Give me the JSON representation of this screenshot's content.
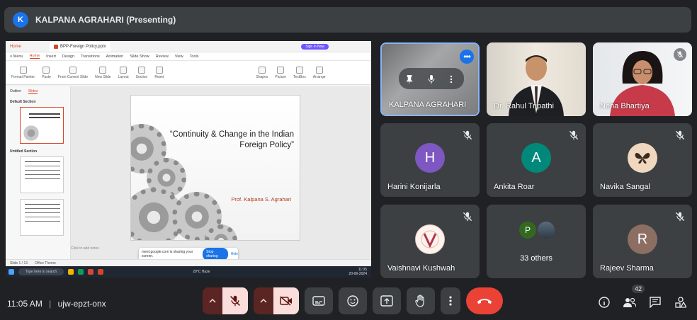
{
  "topbar": {
    "avatar_letter": "K",
    "title": "KALPANA AGRAHARI (Presenting)"
  },
  "presentation": {
    "app_tab": "BPP-Foreign Policy.pptx",
    "home": "Home",
    "signin": "Sign in Now",
    "menu": [
      "≡ Menu",
      "Home",
      "Insert",
      "Design",
      "Transitions",
      "Animation",
      "Slide Show",
      "Review",
      "View",
      "Tools"
    ],
    "ribbon": [
      "Format Painter",
      "Paste",
      "From Current Slide",
      "New Slide",
      "Layout",
      "Section",
      "Reset",
      "Shapes",
      "Picture",
      "TextBox",
      "Arrange"
    ],
    "sidebar": {
      "outline_tab": "Outline",
      "slides_tab": "Slides",
      "section1": "Default Section",
      "section2": "Untitled Section"
    },
    "slide": {
      "title_line1": "“Continuity & Change in the Indian",
      "title_line2": "Foreign Policy”",
      "author": "Prof. Kalpana S. Agrahari"
    },
    "notes": "Click to add notes",
    "share_banner": {
      "text": "meet.google.com is sharing your screen.",
      "stop": "Stop sharing",
      "hide": "Hide"
    },
    "status": {
      "slide_count": "Slide 1 / 13",
      "theme": "Office Theme"
    },
    "taskbar": {
      "search": "Type here to search",
      "weather": "29°C Haze",
      "time": "11:05",
      "date": "20-06-2024"
    }
  },
  "participants": [
    {
      "name": "KALPANA AGRAHARI"
    },
    {
      "name": "Dr. Rahul Tripathi"
    },
    {
      "name": "Neha Bhartiya"
    },
    {
      "name": "Harini Konijarla",
      "initial": "H",
      "color": "#7e57c2"
    },
    {
      "name": "Ankita Roar",
      "initial": "A",
      "color": "#00897b"
    },
    {
      "name": "Navika Sangal"
    },
    {
      "name": "Vaishnavi Kushwah"
    },
    {
      "name": "33 others",
      "initial": "P",
      "color": "#33691e"
    },
    {
      "name": "Rajeev Sharma",
      "initial": "R",
      "color": "#8d6e63"
    }
  ],
  "bottom": {
    "time": "11:05 AM",
    "separator": "|",
    "meeting_code": "ujw-epzt-onx",
    "people_count": "42"
  },
  "colors": {
    "accent": "#8ab4f8",
    "leave": "#ea4335",
    "muted_bg": "#f9dedc"
  }
}
